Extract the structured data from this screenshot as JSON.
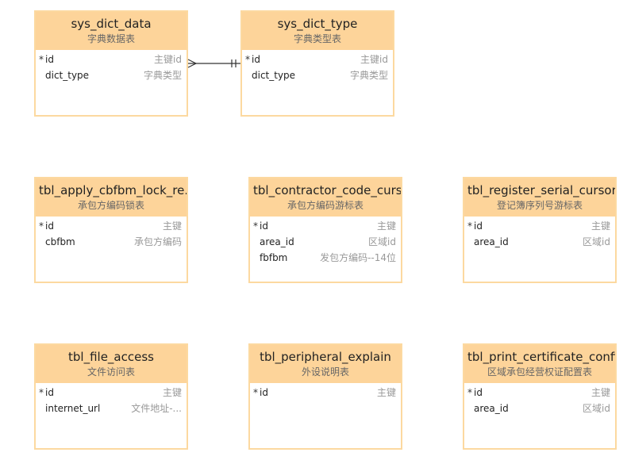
{
  "entities": [
    {
      "name": "sys_dict_data",
      "comment": "字典数据表",
      "fields": [
        {
          "key": "*",
          "name": "id",
          "comment": "主键id"
        },
        {
          "key": "",
          "name": "dict_type",
          "comment": "字典类型"
        }
      ]
    },
    {
      "name": "sys_dict_type",
      "comment": "字典类型表",
      "fields": [
        {
          "key": "*",
          "name": "id",
          "comment": "主键id"
        },
        {
          "key": "",
          "name": "dict_type",
          "comment": "字典类型"
        }
      ]
    },
    {
      "name": "tbl_apply_cbfbm_lock_re...",
      "comment": "承包方编码锁表",
      "fields": [
        {
          "key": "*",
          "name": "id",
          "comment": "主键"
        },
        {
          "key": "",
          "name": "cbfbm",
          "comment": "承包方编码"
        }
      ]
    },
    {
      "name": "tbl_contractor_code_curs...",
      "comment": "承包方编码游标表",
      "fields": [
        {
          "key": "*",
          "name": "id",
          "comment": "主键"
        },
        {
          "key": "",
          "name": "area_id",
          "comment": "区域id"
        },
        {
          "key": "",
          "name": "fbfbm",
          "comment": "发包方编码--14位"
        }
      ]
    },
    {
      "name": "tbl_register_serial_cursor",
      "comment": "登记簿序列号游标表",
      "fields": [
        {
          "key": "*",
          "name": "id",
          "comment": "主键"
        },
        {
          "key": "",
          "name": "area_id",
          "comment": "区域id"
        }
      ]
    },
    {
      "name": "tbl_file_access",
      "comment": "文件访问表",
      "fields": [
        {
          "key": "*",
          "name": "id",
          "comment": "主键"
        },
        {
          "key": "",
          "name": "internet_url",
          "comment": "文件地址-..."
        }
      ]
    },
    {
      "name": "tbl_peripheral_explain",
      "comment": "外设说明表",
      "fields": [
        {
          "key": "*",
          "name": "id",
          "comment": "主键"
        }
      ]
    },
    {
      "name": "tbl_print_certificate_config",
      "comment": "区域承包经营权证配置表",
      "fields": [
        {
          "key": "*",
          "name": "id",
          "comment": "主键"
        },
        {
          "key": "",
          "name": "area_id",
          "comment": "区域id"
        }
      ]
    }
  ],
  "relationships": [
    {
      "from": "sys_dict_data",
      "to": "sys_dict_type",
      "from_cardinality": "many",
      "to_cardinality": "one"
    }
  ],
  "colors": {
    "header_fill": "#fdd49a",
    "border": "#fcd9a0",
    "line": "#333333"
  }
}
